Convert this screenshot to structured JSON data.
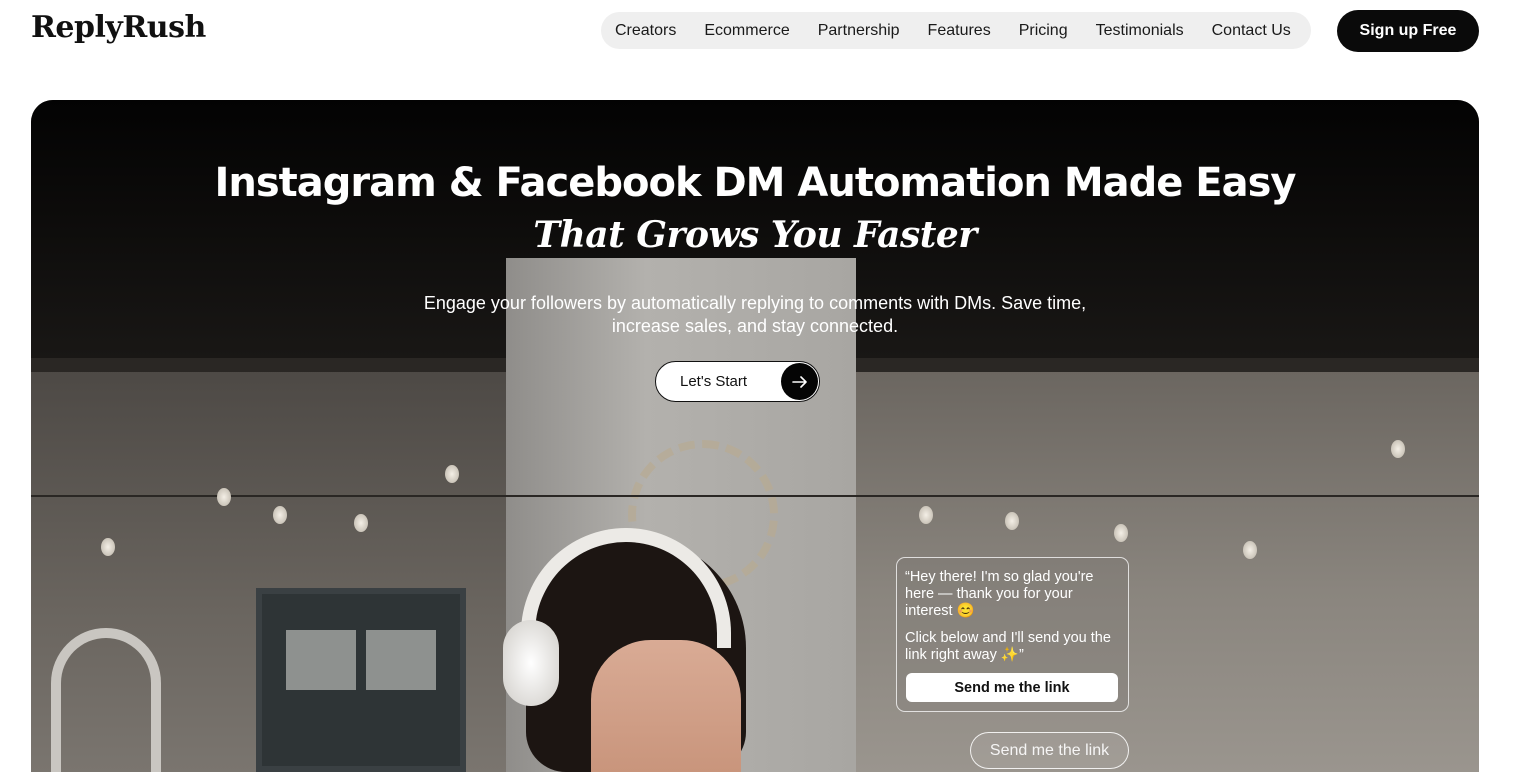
{
  "brand": {
    "logo_text": "ReplyRush"
  },
  "nav": {
    "items": [
      {
        "label": "Creators"
      },
      {
        "label": "Ecommerce"
      },
      {
        "label": "Partnership"
      },
      {
        "label": "Features"
      },
      {
        "label": "Pricing"
      },
      {
        "label": "Testimonials"
      },
      {
        "label": "Contact Us"
      }
    ],
    "signup_label": "Sign up Free"
  },
  "hero": {
    "title": "Instagram & Facebook DM Automation Made Easy",
    "subtitle": "That Grows You Faster",
    "description_line1": "Engage your followers by automatically replying to comments with DMs. Save time,",
    "description_line2": "increase sales, and stay connected.",
    "cta_label": "Let's Start",
    "cta_icon": "arrow-right-icon"
  },
  "dm_preview": {
    "message_part1": "“Hey there! I'm so glad you're here — thank you for your interest 😊",
    "message_part2": "Click below and I'll send you the link right away ✨”",
    "button_label": "Send me the link",
    "reply_bubble": "Send me the link"
  },
  "colors": {
    "primary_dark": "#0a0a0a",
    "nav_bg": "#efefef",
    "text_light": "#ffffff"
  }
}
